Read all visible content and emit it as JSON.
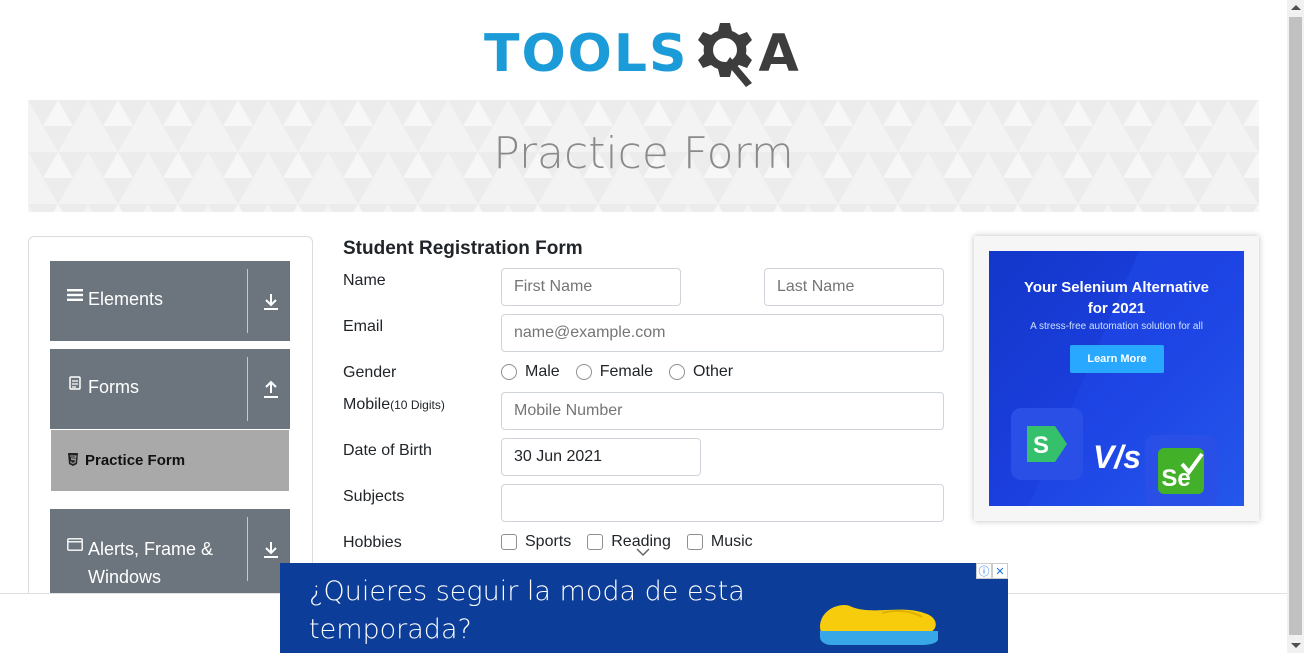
{
  "logo": {
    "part1": "TOOLS",
    "part2": "A"
  },
  "banner": {
    "title": "Practice Form"
  },
  "menu": {
    "groups": [
      {
        "label": "Elements",
        "icon": "hamburger-icon",
        "arrow": "download-icon"
      },
      {
        "label": "Forms",
        "icon": "document-icon",
        "arrow": "upload-icon"
      },
      {
        "label": "Alerts, Frame &",
        "label2": "Windows",
        "icon": "window-icon",
        "arrow": "download-icon"
      }
    ],
    "active_item": {
      "label": "Practice Form",
      "icon": "html5-icon"
    }
  },
  "form": {
    "title": "Student Registration Form",
    "name_label": "Name",
    "first_name_placeholder": "First Name",
    "last_name_placeholder": "Last Name",
    "email_label": "Email",
    "email_placeholder": "name@example.com",
    "gender_label": "Gender",
    "gender_options": [
      "Male",
      "Female",
      "Other"
    ],
    "mobile_label": "Mobile",
    "mobile_hint": "(10 Digits)",
    "mobile_placeholder": "Mobile Number",
    "dob_label": "Date of Birth",
    "dob_value": "30 Jun 2021",
    "subjects_label": "Subjects",
    "subjects_value": "",
    "hobbies_label": "Hobbies",
    "hobbies_options": [
      "Sports",
      "Reading",
      "Music"
    ]
  },
  "ad_right": {
    "headline1": "Your Selenium Alternative",
    "headline2": "for 2021",
    "subtitle": "A stress-free automation solution for all",
    "button": "Learn More",
    "vs": "V/s",
    "logo_left": "S",
    "logo_right": "Se"
  },
  "ad_bottom": {
    "line1": "¿Quieres seguir la moda de esta",
    "line2": "temporada?",
    "info_badge": "ⓘ",
    "close_badge": "✕"
  },
  "colors": {
    "brand_blue": "#1b9bd7",
    "menu_gray": "#6c757d",
    "active_gray": "#a9a9a9",
    "ad_blue": "#0b3d99"
  }
}
